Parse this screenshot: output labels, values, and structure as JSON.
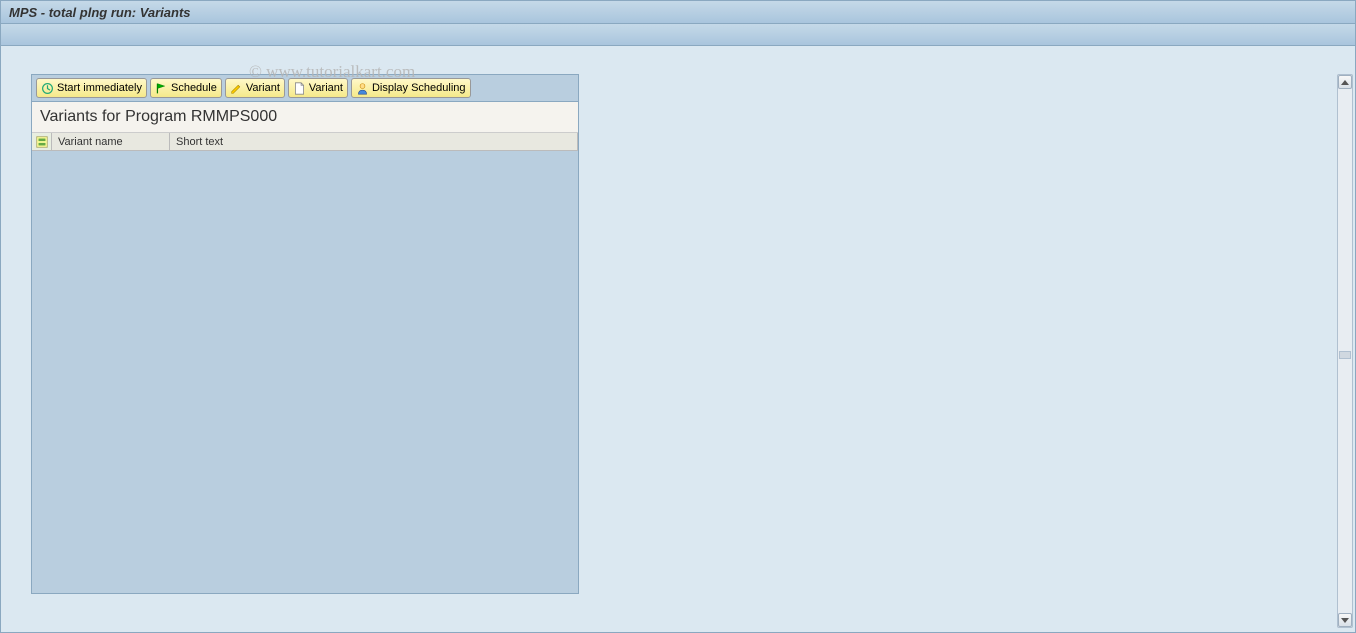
{
  "window": {
    "title": "MPS - total plng run: Variants"
  },
  "watermark": "© www.tutorialkart.com",
  "toolbar": {
    "start_immediately": "Start immediately",
    "schedule": "Schedule",
    "variant_edit": "Variant",
    "variant_new": "Variant",
    "display_scheduling": "Display Scheduling"
  },
  "panel": {
    "title": "Variants for Program RMMPS000"
  },
  "table": {
    "columns": {
      "variant_name": "Variant name",
      "short_text": "Short text"
    },
    "rows": []
  }
}
